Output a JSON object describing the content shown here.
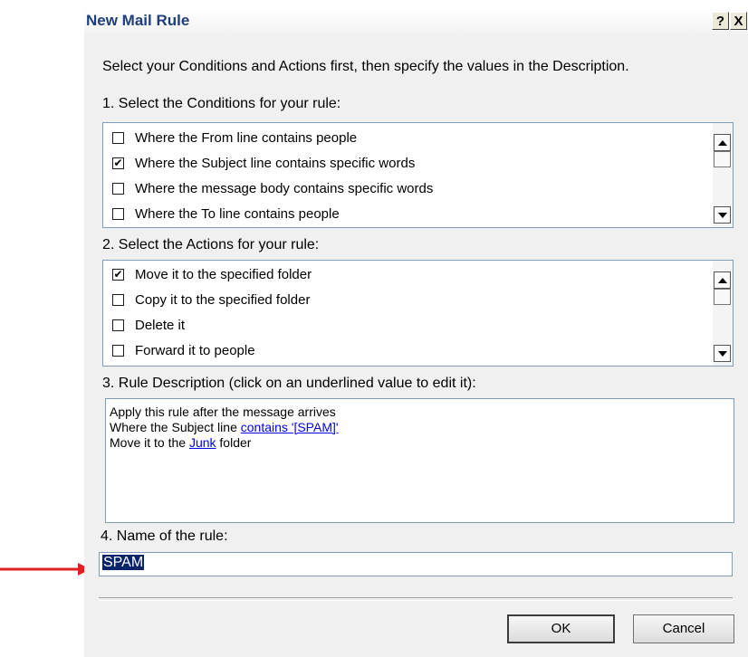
{
  "window": {
    "title": "New Mail Rule",
    "help_glyph": "?",
    "close_glyph": "X"
  },
  "instructions": "Select your Conditions and Actions first, then specify the values in the Description.",
  "conditions": {
    "label": "1. Select the Conditions for your rule:",
    "items": [
      {
        "label": "Where the From line contains people",
        "checked": false
      },
      {
        "label": "Where the Subject line contains specific words",
        "checked": true
      },
      {
        "label": "Where the message body contains specific words",
        "checked": false
      },
      {
        "label": "Where the To line contains people",
        "checked": false
      }
    ]
  },
  "actions": {
    "label": "2. Select the Actions for your rule:",
    "items": [
      {
        "label": "Move it to the specified folder",
        "checked": true
      },
      {
        "label": "Copy it to the specified folder",
        "checked": false
      },
      {
        "label": "Delete it",
        "checked": false
      },
      {
        "label": "Forward it to people",
        "checked": false
      }
    ]
  },
  "description": {
    "label": "3. Rule Description (click on an underlined value to edit it):",
    "line1": "Apply this rule after the message arrives",
    "line2_prefix": "Where the Subject line ",
    "line2_link": "contains '[SPAM]'",
    "line3_prefix": "Move it to the ",
    "line3_link": "Junk",
    "line3_suffix": " folder"
  },
  "rule_name": {
    "label": "4. Name of the rule:",
    "value": "SPAM"
  },
  "buttons": {
    "ok": "OK",
    "cancel": "Cancel"
  },
  "colors": {
    "annotation_arrow": "#e02020",
    "selection": "#0a246a",
    "link": "#0000ee"
  }
}
